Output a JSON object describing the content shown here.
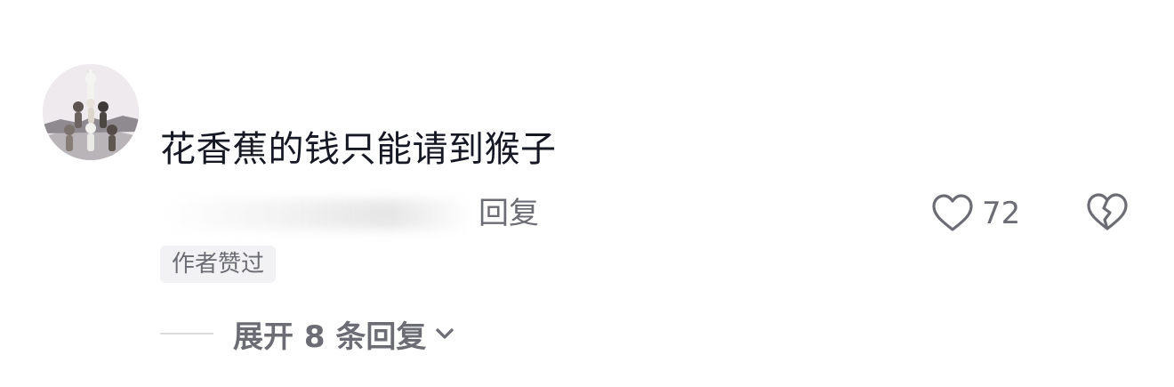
{
  "comment": {
    "author_name": "",
    "text": "花香蕉的钱只能请到猴子",
    "reply_label": "回复",
    "like_count": "72",
    "author_badge": "作者赞过",
    "expand_replies_label": "展开 8 条回复"
  },
  "icons": {
    "like": "heart-outline-icon",
    "dislike": "broken-heart-icon",
    "expand": "chevron-down-icon",
    "avatar": "cats-pyramid-avatar"
  },
  "colors": {
    "text_primary": "#161823",
    "text_secondary": "#6c6d74",
    "badge_bg": "#f2f2f4",
    "divider": "#dcdcdf"
  }
}
